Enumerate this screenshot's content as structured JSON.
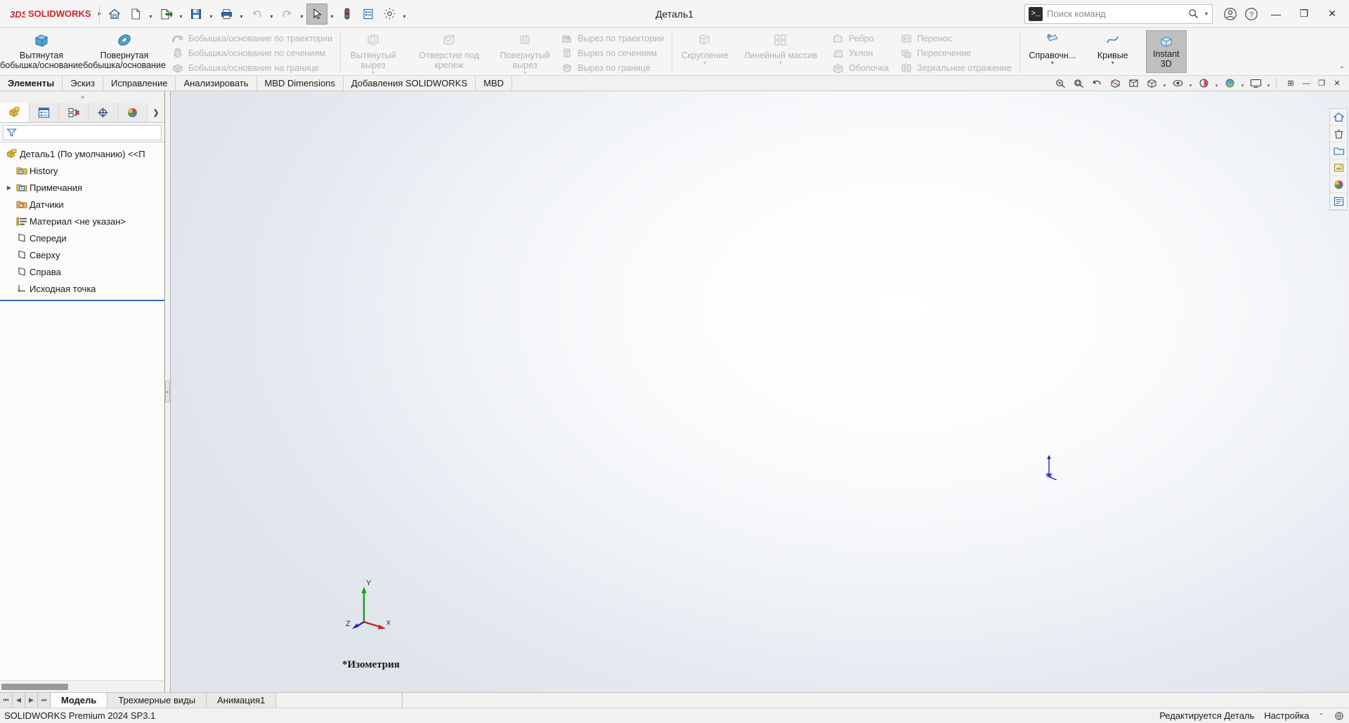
{
  "window": {
    "title": "Деталь1",
    "minimize_label": "—",
    "maximize_label": "❐",
    "close_label": "✕"
  },
  "brand": {
    "ds": "3DS",
    "solid": "SOLID",
    "works": "WORKS"
  },
  "quick_access": {
    "menu_arrow": "▸",
    "buttons": [
      {
        "name": "home-icon",
        "label": "Домой"
      },
      {
        "name": "new-document-icon",
        "label": "Создать"
      },
      {
        "name": "open-document-icon",
        "label": "Открыть"
      },
      {
        "name": "save-icon",
        "label": "Сохранить"
      },
      {
        "name": "print-icon",
        "label": "Печать"
      },
      {
        "name": "undo-icon",
        "label": "Отменить"
      },
      {
        "name": "redo-icon",
        "label": "Повторить"
      },
      {
        "name": "select-cursor-icon",
        "label": "Выбрать"
      },
      {
        "name": "rebuild-icon",
        "label": "Перестроить"
      },
      {
        "name": "file-properties-icon",
        "label": "Свойства файла"
      },
      {
        "name": "options-gear-icon",
        "label": "Настройки"
      }
    ]
  },
  "search": {
    "placeholder": "Поиск команд",
    "prompt_glyph": ">_",
    "magnifier": "search-icon"
  },
  "titlebar_right": {
    "account_icon": "user-account-icon",
    "help_icon": "help-icon"
  },
  "ribbon": {
    "big_buttons": [
      {
        "id": "extruded-boss",
        "label_line1": "Вытянутая",
        "label_line2": "бобышка/основание",
        "enabled": true,
        "icon": "extruded-boss-icon"
      },
      {
        "id": "revolved-boss",
        "label_line1": "Повернутая",
        "label_line2": "бобышка/основание",
        "enabled": true,
        "icon": "revolved-boss-icon"
      }
    ],
    "boss_small": [
      {
        "id": "swept-boss",
        "label": "Бобышка/основание по траектории",
        "enabled": false,
        "icon": "swept-boss-icon"
      },
      {
        "id": "lofted-boss",
        "label": "Бобышка/основание по сечениям",
        "enabled": false,
        "icon": "lofted-boss-icon"
      },
      {
        "id": "boundary-boss",
        "label": "Бобышка/основание на границе",
        "enabled": false,
        "icon": "boundary-boss-icon"
      }
    ],
    "cut_big": [
      {
        "id": "extruded-cut",
        "label_line1": "Вытянутый",
        "label_line2": "вырез",
        "enabled": false,
        "icon": "extruded-cut-icon",
        "has_dropdown": true
      },
      {
        "id": "hole-wizard",
        "label_line1": "Отверстие под крепеж",
        "label_line2": "",
        "enabled": false,
        "icon": "hole-wizard-icon"
      },
      {
        "id": "revolved-cut",
        "label_line1": "Повернутый",
        "label_line2": "вырез",
        "enabled": false,
        "icon": "revolved-cut-icon",
        "has_dropdown": true
      }
    ],
    "cut_small": [
      {
        "id": "swept-cut",
        "label": "Вырез по траектории",
        "enabled": false,
        "icon": "swept-cut-icon"
      },
      {
        "id": "lofted-cut",
        "label": "Вырез по сечениям",
        "enabled": false,
        "icon": "lofted-cut-icon"
      },
      {
        "id": "boundary-cut",
        "label": "Вырез по границе",
        "enabled": false,
        "icon": "boundary-cut-icon"
      }
    ],
    "feature_big": [
      {
        "id": "fillet",
        "label_line1": "Скругление",
        "label_line2": "",
        "enabled": false,
        "icon": "fillet-icon",
        "has_dropdown": true
      },
      {
        "id": "linear-pattern",
        "label_line1": "Линейный массив",
        "label_line2": "",
        "enabled": false,
        "icon": "linear-pattern-icon",
        "has_dropdown": true
      }
    ],
    "feature_small_a": [
      {
        "id": "rib",
        "label": "Ребро",
        "enabled": false,
        "icon": "rib-icon"
      },
      {
        "id": "draft",
        "label": "Уклон",
        "enabled": false,
        "icon": "draft-icon"
      },
      {
        "id": "shell",
        "label": "Оболочка",
        "enabled": false,
        "icon": "shell-icon"
      }
    ],
    "feature_small_b": [
      {
        "id": "move-face",
        "label": "Перенос",
        "enabled": false,
        "icon": "move-face-icon"
      },
      {
        "id": "intersect",
        "label": "Пересечение",
        "enabled": false,
        "icon": "intersect-icon"
      },
      {
        "id": "mirror",
        "label": "Зеркальное отражение",
        "enabled": false,
        "icon": "mirror-icon"
      }
    ],
    "right_big": [
      {
        "id": "reference-geometry",
        "label_line1": "Справочн...",
        "label_line2": "",
        "enabled": true,
        "icon": "reference-geometry-icon",
        "has_dropdown": true
      },
      {
        "id": "curves",
        "label_line1": "Кривые",
        "label_line2": "",
        "enabled": true,
        "icon": "curves-icon",
        "has_dropdown": true
      }
    ],
    "instant3d": {
      "label_line1": "Instant",
      "label_line2": "3D",
      "active": true
    },
    "collapse_caret": "⌃"
  },
  "tabs": [
    {
      "id": "features",
      "label": "Элементы",
      "active": true
    },
    {
      "id": "sketch",
      "label": "Эскиз",
      "active": false
    },
    {
      "id": "markup",
      "label": "Исправление",
      "active": false
    },
    {
      "id": "evaluate",
      "label": "Анализировать",
      "active": false
    },
    {
      "id": "mbd-dimensions",
      "label": "MBD Dimensions",
      "active": false
    },
    {
      "id": "solidworks-addins",
      "label": "Добавления SOLIDWORKS",
      "active": false
    },
    {
      "id": "mbd",
      "label": "MBD",
      "active": false
    }
  ],
  "view_toolbar": [
    {
      "name": "zoom-to-fit-icon"
    },
    {
      "name": "zoom-area-icon"
    },
    {
      "name": "previous-view-icon"
    },
    {
      "name": "section-view-icon"
    },
    {
      "name": "view-orientation-icon"
    },
    {
      "name": "display-style-icon"
    },
    {
      "name": "hide-show-items-icon"
    },
    {
      "name": "edit-appearance-icon"
    },
    {
      "name": "apply-scene-icon"
    },
    {
      "name": "view-settings-icon"
    }
  ],
  "doc_window_buttons": {
    "restore_small": "⊞",
    "minimize": "—",
    "restore": "❐",
    "close": "✕"
  },
  "left_panel": {
    "tabs": [
      {
        "id": "feature-manager",
        "name": "feature-manager-tree-icon",
        "active": true
      },
      {
        "id": "property-manager",
        "name": "property-manager-icon",
        "active": false
      },
      {
        "id": "configuration-manager",
        "name": "configuration-manager-icon",
        "active": false
      },
      {
        "id": "dimxpert-manager",
        "name": "dimxpert-manager-icon",
        "active": false
      },
      {
        "id": "display-manager",
        "name": "display-manager-icon",
        "active": false
      }
    ],
    "more_caret": "❯",
    "filter": {
      "icon": "filter-funnel-icon",
      "value": "",
      "placeholder": ""
    },
    "tree": [
      {
        "id": "part-root",
        "label": "Деталь1 (По умолчанию) <<П",
        "icon": "part-icon",
        "expandable": false,
        "indent": 0
      },
      {
        "id": "history",
        "label": "History",
        "icon": "history-folder-icon",
        "expandable": false,
        "indent": 1
      },
      {
        "id": "annotations",
        "label": "Примечания",
        "icon": "annotations-folder-icon",
        "expandable": true,
        "indent": 1
      },
      {
        "id": "sensors",
        "label": "Датчики",
        "icon": "sensors-folder-icon",
        "expandable": false,
        "indent": 1
      },
      {
        "id": "material",
        "label": "Материал <не указан>",
        "icon": "material-icon",
        "expandable": false,
        "indent": 1
      },
      {
        "id": "front-plane",
        "label": "Спереди",
        "icon": "plane-icon",
        "expandable": false,
        "indent": 1
      },
      {
        "id": "top-plane",
        "label": "Сверху",
        "icon": "plane-icon",
        "expandable": false,
        "indent": 1
      },
      {
        "id": "right-plane",
        "label": "Справа",
        "icon": "plane-icon",
        "expandable": false,
        "indent": 1
      },
      {
        "id": "origin",
        "label": "Исходная точка",
        "icon": "origin-icon",
        "expandable": false,
        "indent": 1
      }
    ]
  },
  "graphics": {
    "view_label": "*Изометрия",
    "triad": {
      "x": "x",
      "y": "Y",
      "z": "Z"
    },
    "right_toolbar": [
      {
        "name": "view-home-icon"
      },
      {
        "name": "delete-view-icon"
      },
      {
        "name": "open-folder-icon"
      },
      {
        "name": "appearances-icon"
      },
      {
        "name": "scenes-sphere-icon"
      },
      {
        "name": "custom-properties-icon"
      }
    ]
  },
  "bottom": {
    "nav": [
      "⏮",
      "◀",
      "▶",
      "⏭"
    ],
    "tabs": [
      {
        "id": "model",
        "label": "Модель",
        "active": true
      },
      {
        "id": "3d-views",
        "label": "Трехмерные виды",
        "active": false
      },
      {
        "id": "animation1",
        "label": "Анимация1",
        "active": false
      }
    ]
  },
  "status": {
    "product": "SOLIDWORKS Premium 2024 SP3.1",
    "editing": "Редактируется Деталь",
    "customize": "Настройка",
    "caret": "⌃",
    "indicator_icon": "overlay-status-icon"
  },
  "colors": {
    "brand_red": "#d21f2a",
    "accent_blue": "#2e6fb7",
    "ribbon_bg": "#f5f5f5",
    "disabled_text": "#b4b4b4"
  }
}
